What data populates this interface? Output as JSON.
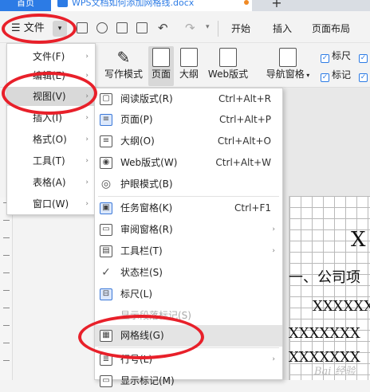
{
  "tabs": {
    "home": "首页",
    "document": "WPS文档如何添加网格线.docx",
    "new_tab": "+"
  },
  "menubar": {
    "file": "文件",
    "file_caret": "▾",
    "items": [
      "开始",
      "插入",
      "页面布局"
    ]
  },
  "ribbon": {
    "buttons": [
      "写作模式",
      "页面",
      "大纲",
      "Web版式",
      "导航窗格"
    ],
    "checkboxes": [
      {
        "label": "标尺",
        "checked": true
      },
      {
        "label": "标记",
        "checked": true
      },
      {
        "label": "",
        "checked": true
      },
      {
        "label": "",
        "checked": true
      }
    ]
  },
  "file_menu": [
    {
      "label": "文件(F)",
      "arrow": "›"
    },
    {
      "label": "编辑(E)",
      "arrow": "›"
    },
    {
      "label": "视图(V)",
      "arrow": "›",
      "selected": true
    },
    {
      "label": "插入(I)",
      "arrow": "›"
    },
    {
      "label": "格式(O)",
      "arrow": "›"
    },
    {
      "label": "工具(T)",
      "arrow": "›"
    },
    {
      "label": "表格(A)",
      "arrow": "›"
    },
    {
      "label": "窗口(W)",
      "arrow": "›"
    }
  ],
  "view_menu": {
    "items": [
      {
        "icon": "book-icon",
        "glyph": "▢",
        "label": "阅读版式(R)",
        "shortcut": "Ctrl+Alt+R"
      },
      {
        "icon": "page-layout-icon",
        "glyph": "≡",
        "label": "页面(P)",
        "shortcut": "Ctrl+Alt+P",
        "active": true
      },
      {
        "icon": "outline-icon",
        "glyph": "≡",
        "label": "大纲(O)",
        "shortcut": "Ctrl+Alt+O"
      },
      {
        "icon": "web-layout-icon",
        "glyph": "◉",
        "label": "Web版式(W)",
        "shortcut": "Ctrl+Alt+W"
      },
      {
        "icon": "eye-icon",
        "glyph": "◎",
        "label": "护眼模式(B)",
        "shortcut": ""
      },
      {
        "icon": "task-pane-icon",
        "glyph": "▣",
        "label": "任务窗格(K)",
        "shortcut": "Ctrl+F1",
        "active": true
      },
      {
        "icon": "review-pane-icon",
        "glyph": "▭",
        "label": "审阅窗格(R)",
        "shortcut": "",
        "arrow": "›"
      },
      {
        "icon": "toolbar-icon",
        "glyph": "▤",
        "label": "工具栏(T)",
        "shortcut": "",
        "arrow": "›"
      },
      {
        "icon": "checkmark-icon",
        "glyph": "✓",
        "label": "状态栏(S)",
        "shortcut": ""
      },
      {
        "icon": "ruler-icon",
        "glyph": "⊟",
        "label": "标尺(L)",
        "shortcut": "",
        "active": true
      },
      {
        "icon": "blank-icon",
        "glyph": "",
        "label": "显示段落标记(S)",
        "shortcut": "",
        "disabled": true
      },
      {
        "icon": "gridlines-icon",
        "glyph": "▦",
        "label": "网格线(G)",
        "shortcut": "",
        "highlighted": true
      },
      {
        "icon": "line-number-icon",
        "glyph": "≣",
        "label": "行号(L)",
        "shortcut": "",
        "arrow": "›"
      },
      {
        "icon": "markup-icon",
        "glyph": "▭",
        "label": "显示标记(M)",
        "shortcut": ""
      }
    ]
  },
  "document": {
    "title_char": "X",
    "heading": "一、公司项",
    "line1": "XXXXXX",
    "line2": "XXXXXXX",
    "line3": "XXXXXXX"
  },
  "watermark": "Bai 经验",
  "colors": {
    "accent": "#2c7be5",
    "annotation": "#e8202a",
    "selection": "#d9d9d9"
  }
}
